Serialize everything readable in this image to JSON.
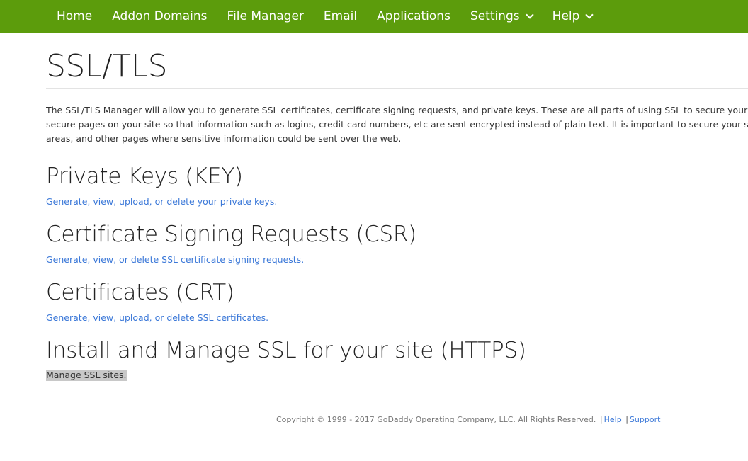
{
  "nav": {
    "items": [
      {
        "label": "Home",
        "has_dropdown": false
      },
      {
        "label": "Addon Domains",
        "has_dropdown": false
      },
      {
        "label": "File Manager",
        "has_dropdown": false
      },
      {
        "label": "Email",
        "has_dropdown": false
      },
      {
        "label": "Applications",
        "has_dropdown": false
      },
      {
        "label": "Settings",
        "has_dropdown": true
      },
      {
        "label": "Help",
        "has_dropdown": true
      }
    ],
    "background_color": "#5c9c0c"
  },
  "page": {
    "title": "SSL/TLS",
    "intro_lines": [
      "The SSL/TLS Manager will allow you to generate SSL certificates, certificate signing requests, and private keys. These are all parts of using SSL to secure your webs",
      "secure pages on your site so that information such as logins, credit card numbers, etc are sent encrypted instead of plain text. It is important to secure your site’s",
      "areas, and other pages where sensitive information could be sent over the web."
    ]
  },
  "sections": [
    {
      "heading": "Private Keys (KEY)",
      "link": "Generate, view, upload, or delete your private keys."
    },
    {
      "heading": "Certificate Signing Requests (CSR)",
      "link": "Generate, view, or delete SSL certificate signing requests."
    },
    {
      "heading": "Certificates (CRT)",
      "link": "Generate, view, upload, or delete SSL certificates."
    },
    {
      "heading": "Install and Manage SSL for your site (HTTPS)",
      "link": "Manage SSL sites."
    }
  ],
  "footer": {
    "copyright": "Copyright © 1999 - 2017 GoDaddy Operating Company, LLC. All Rights Reserved.",
    "separator": "|",
    "help_label": "Help",
    "support_label": "Support"
  },
  "colors": {
    "link": "#3b78d8",
    "highlight": "#c8c8c8"
  }
}
